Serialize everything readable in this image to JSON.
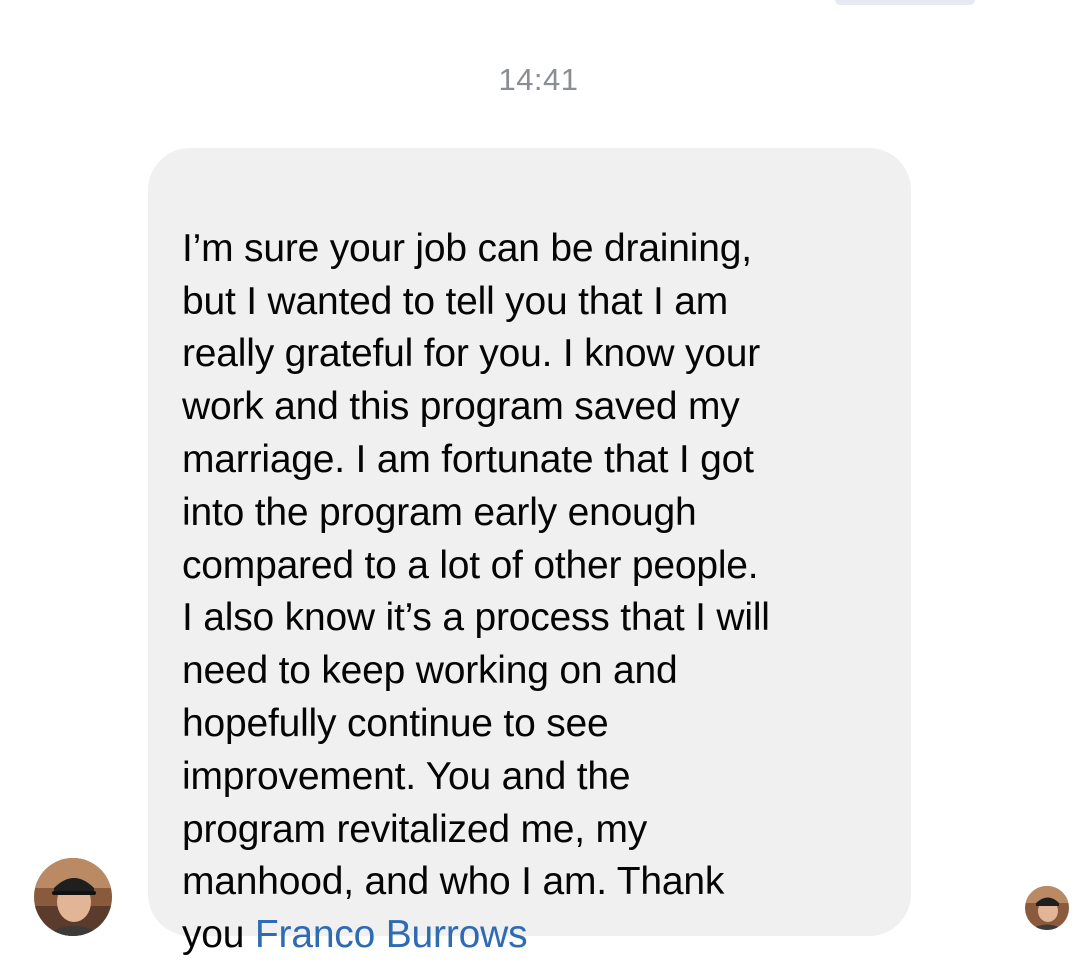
{
  "conversation": {
    "timestamp": "14:41"
  },
  "message": {
    "text_lines": [
      "I’m sure your job can be draining,",
      "but I wanted to tell you that I am",
      "really grateful for you. I know your",
      "work and this program saved my",
      "marriage. I am fortunate that I got",
      "into the program early enough",
      "compared to a lot of other people.",
      "I also know it’s a process that I will",
      "need to keep working on and",
      "hopefully continue to see",
      "improvement. You and the",
      "program revitalized me, my",
      "manhood, and who I am. Thank"
    ],
    "last_line_prefix": "you ",
    "mention": "Franco Burrows"
  },
  "avatars": {
    "sender": "avatar-photo",
    "read_receipt": "avatar-photo"
  },
  "colors": {
    "bubble_bg": "#f0f0f0",
    "mention": "#2d6bb3",
    "timestamp": "#8a8d91",
    "text": "#050505"
  }
}
